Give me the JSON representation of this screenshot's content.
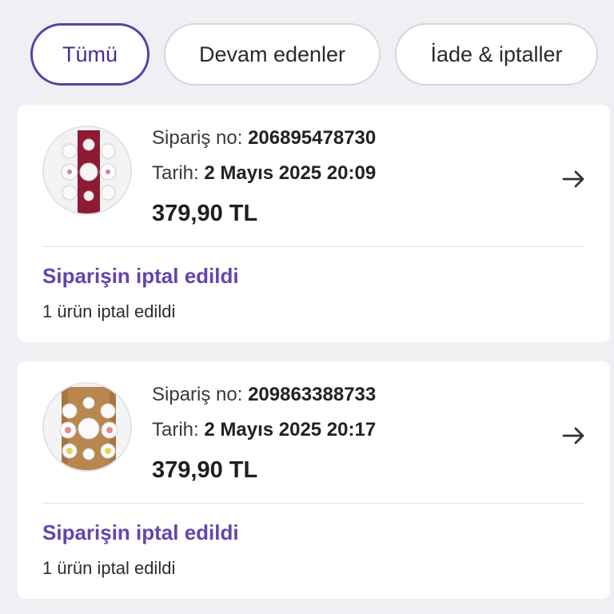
{
  "tabs": {
    "all": "Tümü",
    "ongoing": "Devam edenler",
    "returns": "İade & iptaller"
  },
  "labels": {
    "order_no": "Sipariş no:",
    "date": "Tarih:"
  },
  "orders": [
    {
      "order_no": "206895478730",
      "date": "2 Mayıs 2025 20:09",
      "price": "379,90 TL",
      "status": "Siparişin iptal edildi",
      "detail": "1 ürün iptal edildi",
      "thumb_icon": "plates-red-board-icon"
    },
    {
      "order_no": "209863388733",
      "date": "2 Mayıs 2025 20:17",
      "price": "379,90 TL",
      "status": "Siparişin iptal edildi",
      "detail": "1 ürün iptal edildi",
      "thumb_icon": "plates-wood-board-icon"
    }
  ],
  "colors": {
    "accent": "#5b3fa6",
    "status": "#6444b0",
    "background": "#eef0f4"
  }
}
